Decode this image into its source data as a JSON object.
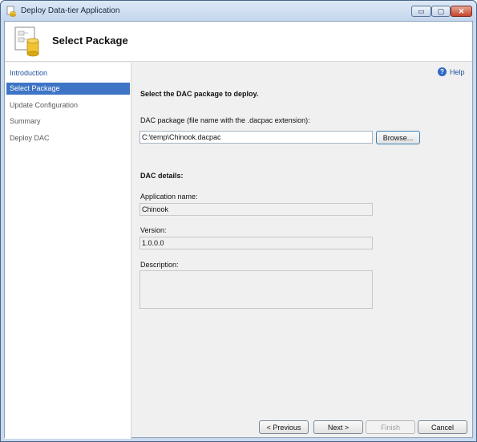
{
  "window": {
    "title": "Deploy Data-tier Application",
    "controls": {
      "minimize": "▭",
      "maximize": "▢",
      "close": "✕"
    }
  },
  "header": {
    "title": "Select Package"
  },
  "nav": {
    "items": [
      {
        "label": "Introduction"
      },
      {
        "label": "Select Package"
      },
      {
        "label": "Update Configuration"
      },
      {
        "label": "Summary"
      },
      {
        "label": "Deploy DAC"
      }
    ]
  },
  "help": {
    "label": "Help",
    "icon": "?"
  },
  "main": {
    "heading": "Select the DAC package to deploy.",
    "package_label": "DAC package (file name with the .dacpac extension):",
    "package_value": "C:\\temp\\Chinook.dacpac",
    "browse_label": "Browse...",
    "details_heading": "DAC details:",
    "app_name_label": "Application name:",
    "app_name_value": "Chinook",
    "version_label": "Version:",
    "version_value": "1.0.0.0",
    "description_label": "Description:",
    "description_value": ""
  },
  "footer": {
    "previous_label": "< Previous",
    "next_label": "Next >",
    "finish_label": "Finish",
    "cancel_label": "Cancel"
  }
}
